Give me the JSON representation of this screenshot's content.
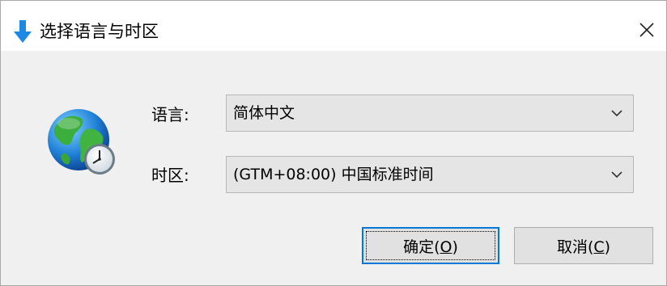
{
  "window": {
    "title": "选择语言与时区",
    "title_icon": "download-arrow-icon",
    "close_icon": "close-icon"
  },
  "form": {
    "icon": "globe-clock-icon",
    "language": {
      "label": "语言:",
      "value": "简体中文",
      "dropdown_icon": "chevron-down-icon"
    },
    "timezone": {
      "label": "时区:",
      "value": "(GTM+08:00) 中国标准时间",
      "dropdown_icon": "chevron-down-icon"
    }
  },
  "buttons": {
    "ok": {
      "text": "确定(",
      "mnemonic": "O",
      "suffix": ")"
    },
    "cancel": {
      "text": "取消(",
      "mnemonic": "C",
      "suffix": ")"
    }
  },
  "colors": {
    "title_icon": "#1e88e5",
    "focus_border": "#0078d7",
    "dialog_background": "#f0f0f0",
    "combobox_background": "#e5e5e5"
  }
}
